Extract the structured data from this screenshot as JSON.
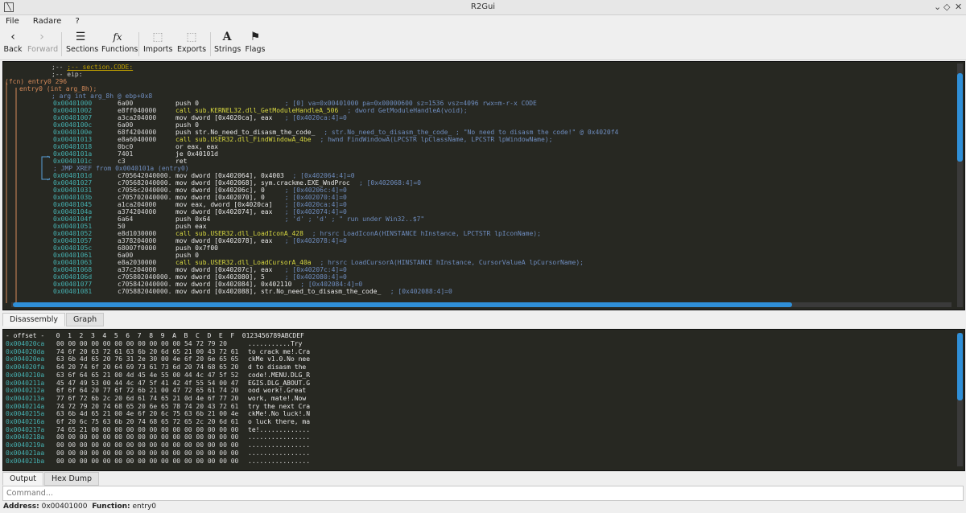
{
  "window": {
    "title": "R2Gui"
  },
  "menu": [
    "File",
    "Radare",
    "?"
  ],
  "toolbar": {
    "back": "Back",
    "forward": "Forward",
    "sections": "Sections",
    "functions": "Functions",
    "imports": "Imports",
    "exports": "Exports",
    "strings": "Strings",
    "flags": "Flags",
    "functions_glyph": "fx",
    "strings_glyph": "A"
  },
  "disasm": {
    "header": [
      ";-- section.CODE:",
      ";-- eip:",
      "(fcn) entry0 296",
      "entry0 (int arg_8h);",
      "; arg int arg_8h @ ebp+0x8"
    ],
    "rows": [
      {
        "addr": "0x00401000",
        "bytes": "6a00",
        "asm": "push 0",
        "cmt": "; [0] va=0x00401000 pa=0x00000600 sz=1536 vsz=4096 rwx=m-r-x CODE"
      },
      {
        "addr": "0x00401002",
        "bytes": "e8ff040000",
        "asm": "call sub.KERNEL32.dll_GetModuleHandleA_506",
        "cmt": "; dword GetModuleHandleA(void);"
      },
      {
        "addr": "0x00401007",
        "bytes": "a3ca204000",
        "asm": "mov dword [0x4020ca], eax",
        "cmt": "; [0x4020ca:4]=0"
      },
      {
        "addr": "0x0040100c",
        "bytes": "6a00",
        "asm": "push 0",
        "cmt": ""
      },
      {
        "addr": "0x0040100e",
        "bytes": "68f4204000",
        "asm": "push str.No_need_to_disasm_the_code_",
        "cmt": "; str.No_need_to_disasm_the_code_ ; \"No need to disasm the code!\" @ 0x4020f4"
      },
      {
        "addr": "0x00401013",
        "bytes": "e8a6040000",
        "asm": "call sub.USER32.dll_FindWindowA_4be",
        "cmt": "; hwnd FindWindowA(LPCSTR lpClassName, LPCSTR lpWindowName);"
      },
      {
        "addr": "0x00401018",
        "bytes": "0bc0",
        "asm": "or eax, eax",
        "cmt": ""
      },
      {
        "addr": "0x0040101a",
        "bytes": "7401",
        "asm": "je 0x40101d",
        "cmt": ""
      },
      {
        "addr": "0x0040101c",
        "bytes": "c3",
        "asm": "ret",
        "cmt": ""
      },
      {
        "addr": "",
        "bytes": "",
        "asm": "; JMP XREF from 0x0040101a (entry0)",
        "cmt": ""
      },
      {
        "addr": "0x0040101d",
        "bytes": "c705642040000.",
        "asm": "mov dword [0x402064], 0x4003",
        "cmt": "; [0x402064:4]=0"
      },
      {
        "addr": "0x00401027",
        "bytes": "c705682040000.",
        "asm": "mov dword [0x402068], sym.crackme.EXE_WndProc",
        "cmt": "; [0x402068:4]=0"
      },
      {
        "addr": "0x00401031",
        "bytes": "c7056c2040000.",
        "asm": "mov dword [0x40206c], 0",
        "cmt": "; [0x40206c:4]=0"
      },
      {
        "addr": "0x0040103b",
        "bytes": "c705702040000.",
        "asm": "mov dword [0x402070], 0",
        "cmt": "; [0x402070:4]=0"
      },
      {
        "addr": "0x00401045",
        "bytes": "a1ca204000",
        "asm": "mov eax, dword [0x4020ca]",
        "cmt": "; [0x4020ca:4]=0"
      },
      {
        "addr": "0x0040104a",
        "bytes": "a374204000",
        "asm": "mov dword [0x402074], eax",
        "cmt": "; [0x402074:4]=0"
      },
      {
        "addr": "0x0040104f",
        "bytes": "6a64",
        "asm": "push 0x64",
        "cmt": "; 'd' ; 'd' ; \" run under Win32..$7\""
      },
      {
        "addr": "0x00401051",
        "bytes": "50",
        "asm": "push eax",
        "cmt": ""
      },
      {
        "addr": "0x00401052",
        "bytes": "e8d1030000",
        "asm": "call sub.USER32.dll_LoadIconA_428",
        "cmt": "; hrsrc LoadIconA(HINSTANCE hInstance, LPCTSTR lpIconName);"
      },
      {
        "addr": "0x00401057",
        "bytes": "a378204000",
        "asm": "mov dword [0x402078], eax",
        "cmt": "; [0x402078:4]=0"
      },
      {
        "addr": "0x0040105c",
        "bytes": "68007f0000",
        "asm": "push 0x7f00",
        "cmt": ""
      },
      {
        "addr": "0x00401061",
        "bytes": "6a00",
        "asm": "push 0",
        "cmt": ""
      },
      {
        "addr": "0x00401063",
        "bytes": "e8a2030000",
        "asm": "call sub.USER32.dll_LoadCursorA_40a",
        "cmt": "; hrsrc LoadCursorA(HINSTANCE hInstance, CursorValueA lpCursorName);"
      },
      {
        "addr": "0x00401068",
        "bytes": "a37c204000",
        "asm": "mov dword [0x40207c], eax",
        "cmt": "; [0x40207c:4]=0"
      },
      {
        "addr": "0x0040106d",
        "bytes": "c705802040000.",
        "asm": "mov dword [0x402080], 5",
        "cmt": "; [0x402080:4]=0"
      },
      {
        "addr": "0x00401077",
        "bytes": "c705842040000.",
        "asm": "mov dword [0x402084], 0x402110",
        "cmt": "; [0x402084:4]=0"
      },
      {
        "addr": "0x00401081",
        "bytes": "c705882040000.",
        "asm": "mov dword [0x402088], str.No_need_to_disasm_the_code_",
        "cmt": "; [0x402088:4]=0"
      }
    ]
  },
  "center_tabs": [
    "Disassembly",
    "Graph"
  ],
  "hexdump": {
    "header": "- offset -   0  1  2  3  4  5  6  7  8  9  A  B  C  D  E  F  0123456789ABCDEF",
    "rows": [
      {
        "off": "0x004020ca",
        "hex": "00 00 00 00 00 00 00 00 00 00 00 54 72 79 20",
        "asc": "...........Try "
      },
      {
        "off": "0x004020da",
        "hex": "74 6f 20 63 72 61 63 6b 20 6d 65 21 00 43 72 61",
        "asc": "to crack me!.Cra"
      },
      {
        "off": "0x004020ea",
        "hex": "63 6b 4d 65 20 76 31 2e 30 00 4e 6f 20 6e 65 65",
        "asc": "ckMe v1.0.No nee"
      },
      {
        "off": "0x004020fa",
        "hex": "64 20 74 6f 20 64 69 73 61 73 6d 20 74 68 65 20",
        "asc": "d to disasm the "
      },
      {
        "off": "0x0040210a",
        "hex": "63 6f 64 65 21 00 4d 45 4e 55 00 44 4c 47 5f 52",
        "asc": "code!.MENU.DLG_R"
      },
      {
        "off": "0x0040211a",
        "hex": "45 47 49 53 00 44 4c 47 5f 41 42 4f 55 54 00 47",
        "asc": "EGIS.DLG_ABOUT.G"
      },
      {
        "off": "0x0040212a",
        "hex": "6f 6f 64 20 77 6f 72 6b 21 00 47 72 65 61 74 20",
        "asc": "ood work!.Great "
      },
      {
        "off": "0x0040213a",
        "hex": "77 6f 72 6b 2c 20 6d 61 74 65 21 0d 4e 6f 77 20",
        "asc": "work, mate!.Now "
      },
      {
        "off": "0x0040214a",
        "hex": "74 72 79 20 74 68 65 20 6e 65 78 74 20 43 72 61",
        "asc": "try the next Cra"
      },
      {
        "off": "0x0040215a",
        "hex": "63 6b 4d 65 21 00 4e 6f 20 6c 75 63 6b 21 00 4e",
        "asc": "ckMe!.No luck!.N"
      },
      {
        "off": "0x0040216a",
        "hex": "6f 20 6c 75 63 6b 20 74 68 65 72 65 2c 20 6d 61",
        "asc": "o luck there, ma"
      },
      {
        "off": "0x0040217a",
        "hex": "74 65 21 00 00 00 00 00 00 00 00 00 00 00 00 00",
        "asc": "te!............."
      },
      {
        "off": "0x0040218a",
        "hex": "00 00 00 00 00 00 00 00 00 00 00 00 00 00 00 00",
        "asc": "................"
      },
      {
        "off": "0x0040219a",
        "hex": "00 00 00 00 00 00 00 00 00 00 00 00 00 00 00 00",
        "asc": "................"
      },
      {
        "off": "0x004021aa",
        "hex": "00 00 00 00 00 00 00 00 00 00 00 00 00 00 00 00",
        "asc": "................"
      },
      {
        "off": "0x004021ba",
        "hex": "00 00 00 00 00 00 00 00 00 00 00 00 00 00 00 00",
        "asc": "................"
      }
    ]
  },
  "bottom_tabs": [
    "Output",
    "Hex Dump"
  ],
  "command": {
    "placeholder": "Command..."
  },
  "status": {
    "address_label": "Address:",
    "address": "0x00401000",
    "function_label": "Function:",
    "function": "entry0"
  }
}
